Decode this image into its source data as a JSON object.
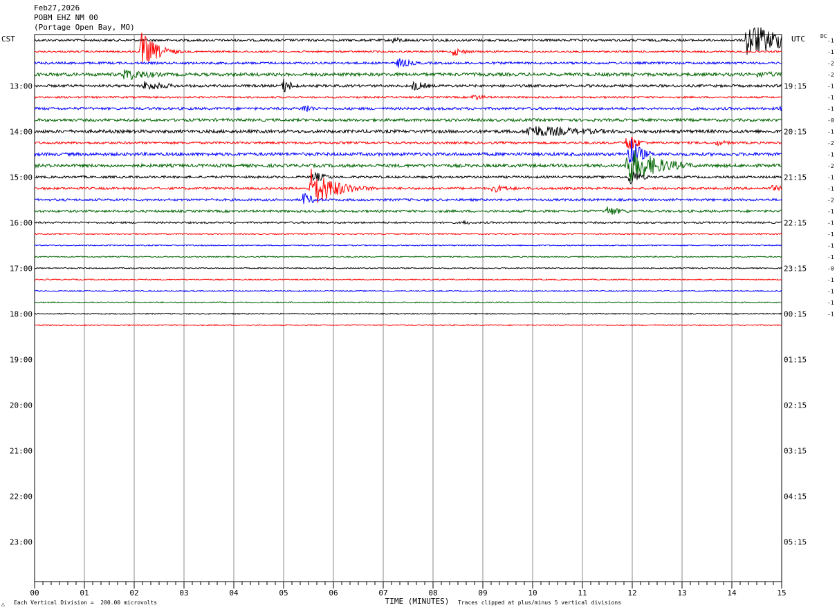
{
  "header": {
    "date": "Feb27,2026",
    "station": "POBM EHZ NM 00",
    "location": "(Portage Open Bay, MO)"
  },
  "labels": {
    "left_tz": "CST",
    "right_tz": "UTC",
    "dc": "DC",
    "footer_scale": "Each Vertical Division =  200.00 microvolts",
    "footer_clip": "Traces clipped at plus/minus 5 vertical divisions",
    "footer_mark": "△"
  },
  "chart_data": {
    "type": "line",
    "title": "",
    "xlabel": "TIME (MINUTES)",
    "ylabel": "",
    "xlim": [
      0,
      15
    ],
    "x_ticks": [
      "00",
      "01",
      "02",
      "03",
      "04",
      "05",
      "06",
      "07",
      "08",
      "09",
      "10",
      "11",
      "12",
      "13",
      "14",
      "15"
    ],
    "minutes_per_line": 15,
    "lines_total": 48,
    "colors": [
      "#000000",
      "#ff0000",
      "#0000ff",
      "#006400"
    ],
    "left_hour_labels": [
      "13:00",
      "14:00",
      "15:00",
      "16:00",
      "17:00",
      "18:00",
      "19:00",
      "20:00",
      "21:00",
      "22:00",
      "23:00"
    ],
    "right_hour_labels": [
      "19:15",
      "20:15",
      "21:15",
      "22:15",
      "23:15",
      "00:15",
      "01:15",
      "02:15",
      "03:15",
      "04:15",
      "05:15"
    ],
    "dc_offsets": [
      "-1",
      "-1",
      "-2",
      "-2",
      "-1",
      "-1",
      "-1",
      "-0",
      "-1",
      "-2",
      "-1",
      "-2",
      "-1",
      "-1",
      "-2",
      "-1",
      "-1",
      "-1",
      "-1",
      "-1",
      "-0",
      "-1",
      "-1",
      "-1",
      "-1"
    ],
    "traces": [
      {
        "line": 0,
        "amp": 0.1,
        "events": [
          {
            "t": 7.2,
            "a": 0.3,
            "d": 0.3
          },
          {
            "t": 14.3,
            "a": 1.6,
            "d": 0.8
          }
        ]
      },
      {
        "line": 1,
        "amp": 0.08,
        "events": [
          {
            "t": 2.15,
            "a": 1.8,
            "d": 0.3
          },
          {
            "t": 8.4,
            "a": 0.4,
            "d": 0.3
          }
        ]
      },
      {
        "line": 2,
        "amp": 0.1,
        "events": [
          {
            "t": 7.3,
            "a": 0.5,
            "d": 0.3
          }
        ]
      },
      {
        "line": 3,
        "amp": 0.14,
        "events": [
          {
            "t": 1.8,
            "a": 0.6,
            "d": 0.6
          },
          {
            "t": 14.5,
            "a": 0.3,
            "d": 0.8
          }
        ]
      },
      {
        "line": 4,
        "amp": 0.11,
        "events": [
          {
            "t": 2.2,
            "a": 0.5,
            "d": 0.5
          },
          {
            "t": 5.0,
            "a": 0.7,
            "d": 0.2
          },
          {
            "t": 7.6,
            "a": 0.5,
            "d": 0.3
          }
        ]
      },
      {
        "line": 5,
        "amp": 0.08,
        "events": [
          {
            "t": 8.8,
            "a": 0.3,
            "d": 0.3
          }
        ]
      },
      {
        "line": 6,
        "amp": 0.11,
        "events": [
          {
            "t": 5.4,
            "a": 0.5,
            "d": 0.2
          },
          {
            "t": 15.0,
            "a": 0.6,
            "d": 0.1
          }
        ]
      },
      {
        "line": 7,
        "amp": 0.12,
        "events": []
      },
      {
        "line": 8,
        "amp": 0.14,
        "events": [
          {
            "t": 9.9,
            "a": 0.6,
            "d": 1.3
          }
        ]
      },
      {
        "line": 9,
        "amp": 0.1,
        "events": [
          {
            "t": 11.9,
            "a": 1.0,
            "d": 0.2
          },
          {
            "t": 13.7,
            "a": 0.3,
            "d": 0.3
          }
        ]
      },
      {
        "line": 10,
        "amp": 0.14,
        "events": [
          {
            "t": 11.95,
            "a": 1.8,
            "d": 0.2
          }
        ]
      },
      {
        "line": 11,
        "amp": 0.14,
        "events": [
          {
            "t": 11.9,
            "a": 1.8,
            "d": 0.6
          }
        ]
      },
      {
        "line": 12,
        "amp": 0.1,
        "events": [
          {
            "t": 5.6,
            "a": 0.5,
            "d": 0.3
          },
          {
            "t": 11.95,
            "a": 0.9,
            "d": 0.2
          }
        ]
      },
      {
        "line": 13,
        "amp": 0.1,
        "events": [
          {
            "t": 5.55,
            "a": 1.8,
            "d": 0.5
          },
          {
            "t": 9.2,
            "a": 0.4,
            "d": 0.4
          },
          {
            "t": 14.8,
            "a": 0.3,
            "d": 0.4
          }
        ]
      },
      {
        "line": 14,
        "amp": 0.1,
        "events": [
          {
            "t": 5.4,
            "a": 0.7,
            "d": 0.2
          }
        ]
      },
      {
        "line": 15,
        "amp": 0.1,
        "events": [
          {
            "t": 11.5,
            "a": 0.5,
            "d": 0.3
          }
        ]
      },
      {
        "line": 16,
        "amp": 0.08,
        "events": [
          {
            "t": 8.6,
            "a": 0.2,
            "d": 0.3
          }
        ]
      },
      {
        "line": 17,
        "amp": 0.05,
        "events": []
      },
      {
        "line": 18,
        "amp": 0.05,
        "events": []
      },
      {
        "line": 19,
        "amp": 0.05,
        "events": []
      },
      {
        "line": 20,
        "amp": 0.05,
        "events": []
      },
      {
        "line": 21,
        "amp": 0.05,
        "events": []
      },
      {
        "line": 22,
        "amp": 0.05,
        "events": []
      },
      {
        "line": 23,
        "amp": 0.05,
        "events": []
      },
      {
        "line": 24,
        "amp": 0.05,
        "events": []
      },
      {
        "line": 25,
        "amp": 0.05,
        "events": []
      }
    ]
  }
}
